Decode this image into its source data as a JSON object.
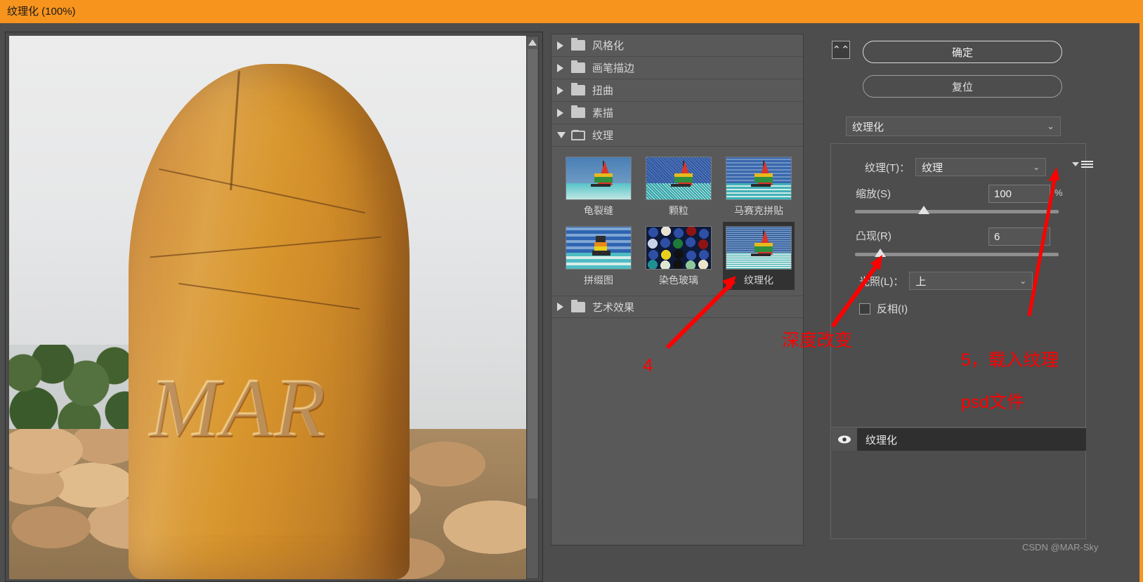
{
  "window": {
    "title": "纹理化 (100%)",
    "titlebar_color": "#f7941d"
  },
  "preview": {
    "stone_engraving": "MAR",
    "scroll_up_icon": "triangle-up-icon"
  },
  "gallery": {
    "categories": [
      {
        "label": "风格化",
        "expanded": false
      },
      {
        "label": "画笔描边",
        "expanded": false
      },
      {
        "label": "扭曲",
        "expanded": false
      },
      {
        "label": "素描",
        "expanded": false
      },
      {
        "label": "纹理",
        "expanded": true
      },
      {
        "label": "艺术效果",
        "expanded": false
      }
    ],
    "thumbnails": [
      {
        "label": "龟裂缝",
        "selected": false
      },
      {
        "label": "颗粒",
        "selected": false
      },
      {
        "label": "马赛克拼贴",
        "selected": false
      },
      {
        "label": "拼缀图",
        "selected": false
      },
      {
        "label": "染色玻璃",
        "selected": false
      },
      {
        "label": "纹理化",
        "selected": true
      }
    ]
  },
  "options": {
    "collapse_icon": "chevron-double-up-icon",
    "ok_label": "确定",
    "reset_label": "复位",
    "filter_name": "纹理化",
    "texture": {
      "label": "纹理(T)：",
      "value": "纹理",
      "menu_icon": "hamburger-menu-icon"
    },
    "scale": {
      "label": "缩放(S)",
      "value": "100",
      "unit": "%"
    },
    "relief": {
      "label": "凸现(R)",
      "value": "6"
    },
    "light": {
      "label": "光照(L)：",
      "value": "上"
    },
    "invert": {
      "label": "反相(I)",
      "checked": false
    }
  },
  "layers": {
    "eye_icon": "eye-icon",
    "items": [
      {
        "name": "纹理化"
      }
    ]
  },
  "annotations": {
    "color": "#ff0000",
    "marker_4": "4",
    "depth_change": "深度改变",
    "load_texture_line1": "5，载入纹理",
    "load_texture_line2": "psd文件"
  },
  "watermark": "CSDN @MAR-Sky"
}
